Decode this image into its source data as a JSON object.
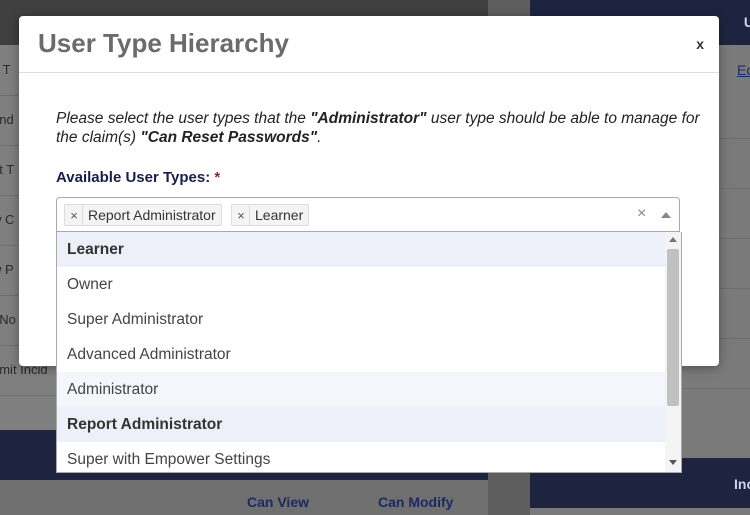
{
  "background": {
    "left_rows": [
      "e T",
      "end",
      "et T",
      "w C",
      "w P",
      ": No",
      "omit Incid"
    ],
    "columns": {
      "can_view": "Can View",
      "can_modify": "Can Modify"
    },
    "right_header": "U",
    "right_link": "Ec",
    "right_band": "Inc"
  },
  "modal": {
    "title": "User Type Hierarchy",
    "close_label": "x",
    "instruction": {
      "part1": "Please select the user types that the ",
      "user_type": "\"Administrator\"",
      "part2": " user type should be able to manage for the claim(s) ",
      "claim": "\"Can Reset Passwords\"",
      "part3": "."
    },
    "field_label": "Available User Types:",
    "required_marker": "*",
    "selected_chips": [
      "Report Administrator",
      "Learner"
    ],
    "chip_remove": "×",
    "clear_all": "×",
    "options": [
      "Learner",
      "Owner",
      "Super Administrator",
      "Advanced Administrator",
      "Administrator",
      "Report Administrator",
      "Super with Empower Settings"
    ]
  },
  "colors": {
    "selected_option_bg": "#eef0f9",
    "label_navy": "#1a1f4a",
    "required_red": "#8b2c2c"
  }
}
